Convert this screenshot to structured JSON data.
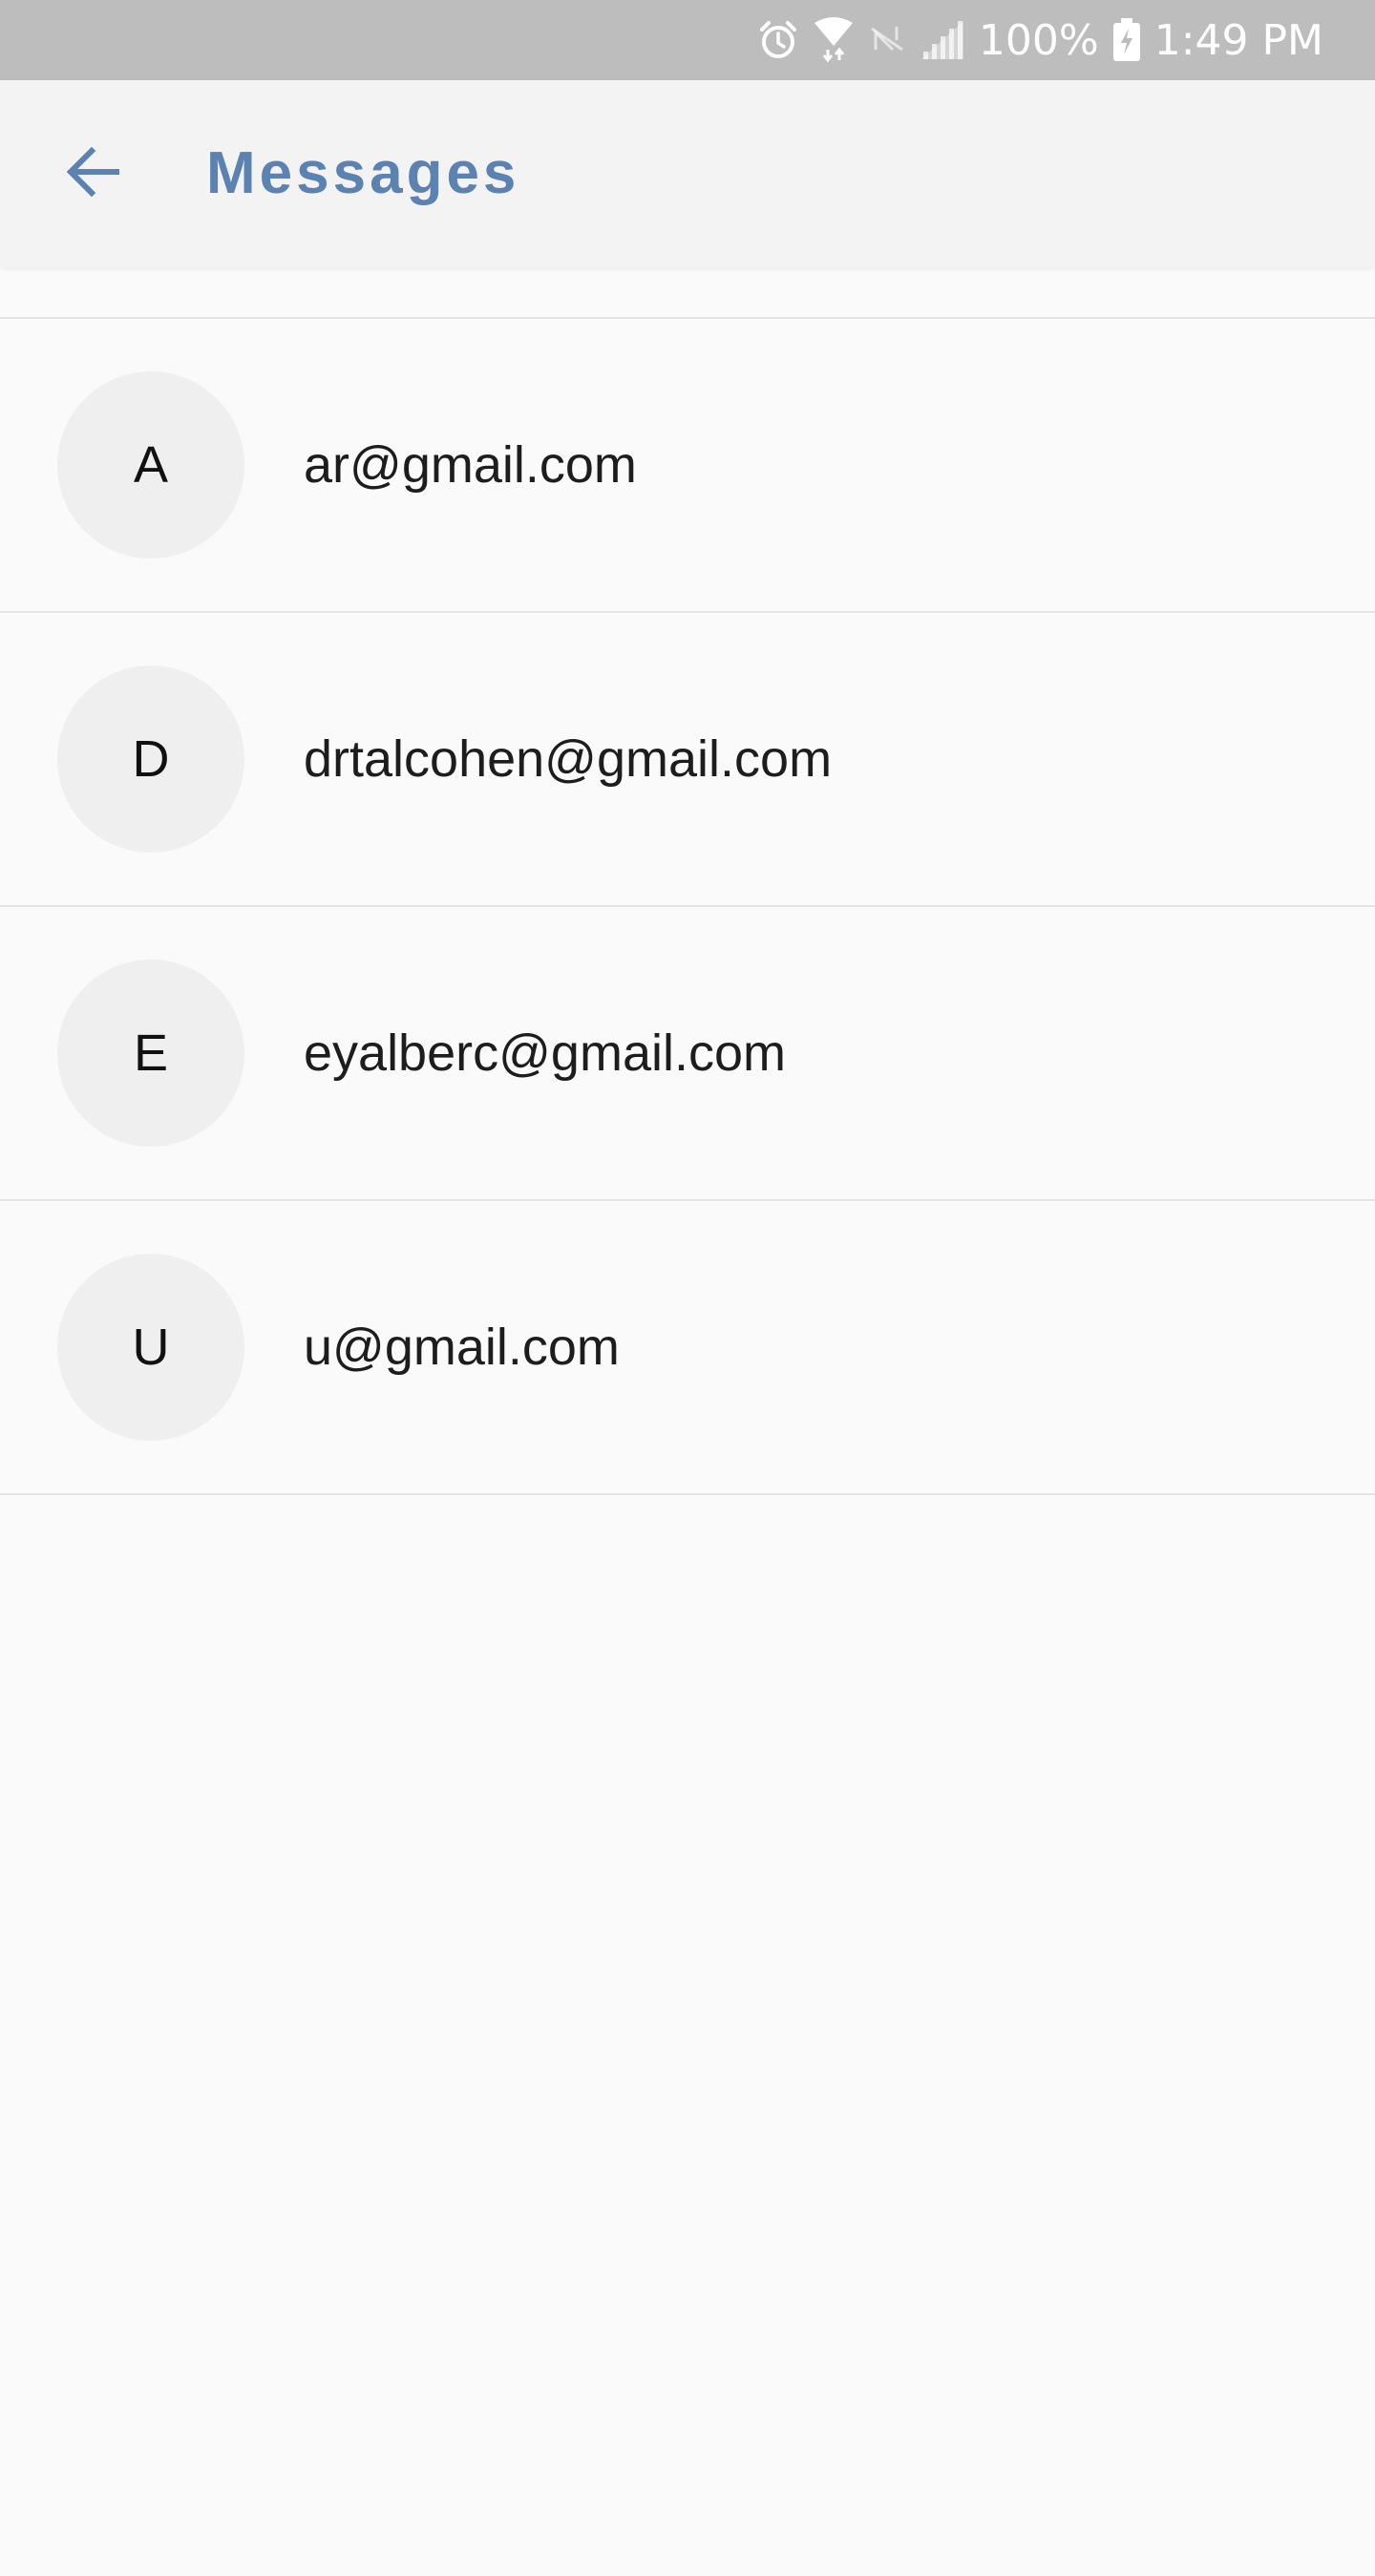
{
  "status_bar": {
    "battery": "100%",
    "time": "1:49 PM",
    "icons": [
      "alarm-icon",
      "wifi-icon",
      "no-signal-icon",
      "cell-signal-icon",
      "battery-charging-icon"
    ]
  },
  "app_bar": {
    "back_icon": "arrow-left-icon",
    "title": "Messages"
  },
  "colors": {
    "accent": "#5b82b0",
    "status_bar_bg": "#bdbdbd",
    "app_bar_bg": "#f3f3f3",
    "list_bg": "#fafafa",
    "avatar_bg": "#efefef",
    "divider": "#e4e4e4"
  },
  "conversations": [
    {
      "initial": "A",
      "label": "ar@gmail.com"
    },
    {
      "initial": "D",
      "label": "drtalcohen@gmail.com"
    },
    {
      "initial": "E",
      "label": "eyalberc@gmail.com"
    },
    {
      "initial": "U",
      "label": "u@gmail.com"
    }
  ]
}
